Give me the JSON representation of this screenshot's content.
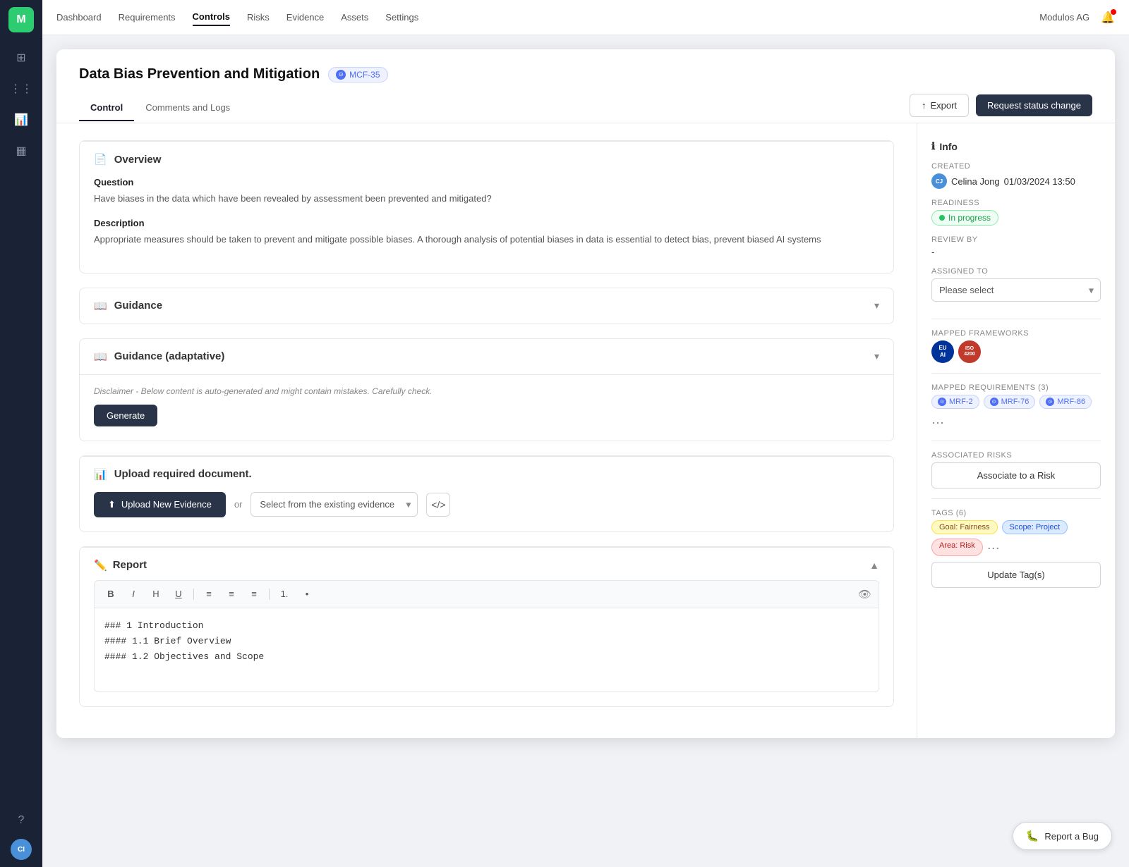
{
  "nav": {
    "items": [
      {
        "label": "Dashboard",
        "active": false
      },
      {
        "label": "Requirements",
        "active": false
      },
      {
        "label": "Controls",
        "active": true
      },
      {
        "label": "Risks",
        "active": false
      },
      {
        "label": "Evidence",
        "active": false
      },
      {
        "label": "Assets",
        "active": false
      },
      {
        "label": "Settings",
        "active": false
      }
    ],
    "user": "Modulos AG"
  },
  "header": {
    "title": "Data Bias Prevention and Mitigation",
    "badge": "MCF-35",
    "tabs": [
      {
        "label": "Control",
        "active": true
      },
      {
        "label": "Comments and Logs",
        "active": false
      }
    ],
    "export_label": "Export",
    "request_label": "Request status change"
  },
  "overview": {
    "section_title": "Overview",
    "question_label": "Question",
    "question_text": "Have biases in the data which have been revealed by assessment been prevented and mitigated?",
    "description_label": "Description",
    "description_text": "Appropriate measures should be taken to prevent and mitigate possible biases. A thorough analysis of potential biases in data is essential to detect bias, prevent biased AI systems"
  },
  "guidance": {
    "section_title": "Guidance"
  },
  "guidance_adaptive": {
    "section_title": "Guidance (adaptative)",
    "disclaimer": "Disclaimer - Below content is auto-generated and might contain mistakes. Carefully check.",
    "generate_label": "Generate"
  },
  "upload": {
    "section_title": "Upload required document.",
    "upload_btn_label": "Upload New Evidence",
    "or_label": "or",
    "select_placeholder": "Select from the existing evidence",
    "code_icon": "<>"
  },
  "report_section": {
    "section_title": "Report",
    "editor_content_line1": "### 1 Introduction",
    "editor_content_line2": "#### 1.1 Brief Overview",
    "editor_content_line3": "#### 1.2 Objectives and Scope",
    "toolbar_buttons": [
      "B",
      "I",
      "H",
      "U",
      "≡",
      "≡",
      "≡",
      "≡",
      "≡"
    ]
  },
  "right_panel": {
    "info_title": "Info",
    "created_label": "Created",
    "created_user": "Celina Jong",
    "created_date": "01/03/2024 13:50",
    "readiness_label": "Readiness",
    "readiness_value": "In progress",
    "review_label": "Review by",
    "review_value": "-",
    "assigned_label": "Assigned to",
    "assigned_placeholder": "Please select",
    "mapped_fw_label": "Mapped Frameworks",
    "mapped_req_label": "Mapped Requirements (3)",
    "requirements": [
      {
        "label": "MRF-2"
      },
      {
        "label": "MRF-76"
      },
      {
        "label": "MRF-86"
      }
    ],
    "associated_risks_label": "Associated Risks",
    "associate_btn_label": "Associate to a Risk",
    "tags_label": "TAGS (6)",
    "tags": [
      {
        "label": "Goal: Fairness",
        "type": "goal"
      },
      {
        "label": "Scope: Project",
        "type": "scope"
      },
      {
        "label": "Area: Risk",
        "type": "area"
      }
    ],
    "update_tags_label": "Update Tag(s)"
  },
  "report_bug": {
    "label": "Report a Bug"
  }
}
